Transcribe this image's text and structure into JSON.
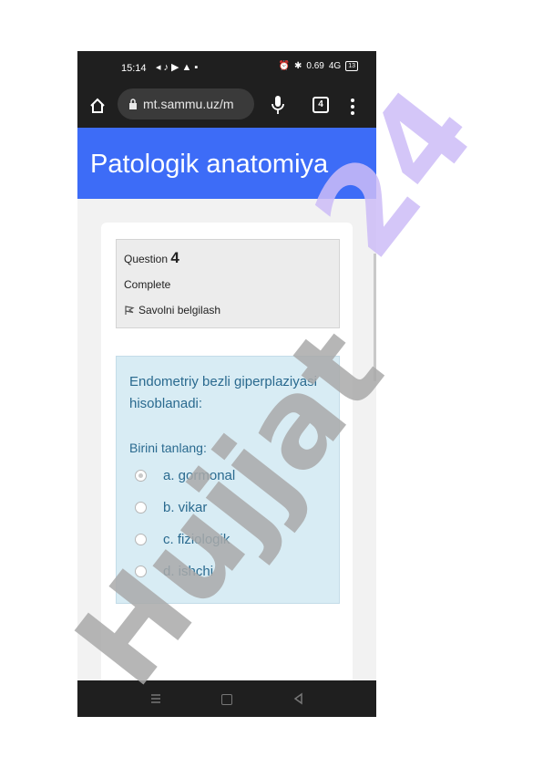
{
  "status_bar": {
    "time": "15:14",
    "network_speed": "0.69",
    "network_unit": "KB/S",
    "signal_label": "4G",
    "battery": "13"
  },
  "browser": {
    "url": "mt.sammu.uz/m",
    "tab_count": "4"
  },
  "header": {
    "title": "Patologik anatomiya"
  },
  "question_info": {
    "label": "Question",
    "number": "4",
    "state": "Complete",
    "flag_label": "Savolni belgilash"
  },
  "question": {
    "text": "Endometriy bezli giperplaziyasi hisoblanadi:",
    "prompt": "Birini tanlang:",
    "options": [
      {
        "label": "a. gormonal",
        "selected": true
      },
      {
        "label": "b. vikar",
        "selected": false
      },
      {
        "label": "c. fiziologik",
        "selected": false
      },
      {
        "label": "d. ishchi",
        "selected": false
      }
    ]
  },
  "watermark": {
    "text": "Hujjat24",
    "color": "#a9a9a9",
    "accent_color": "#cdbcf7"
  },
  "colors": {
    "header": "#3d6cf7",
    "question_bg": "#d8ecf4",
    "question_text": "#2a6a8f"
  }
}
